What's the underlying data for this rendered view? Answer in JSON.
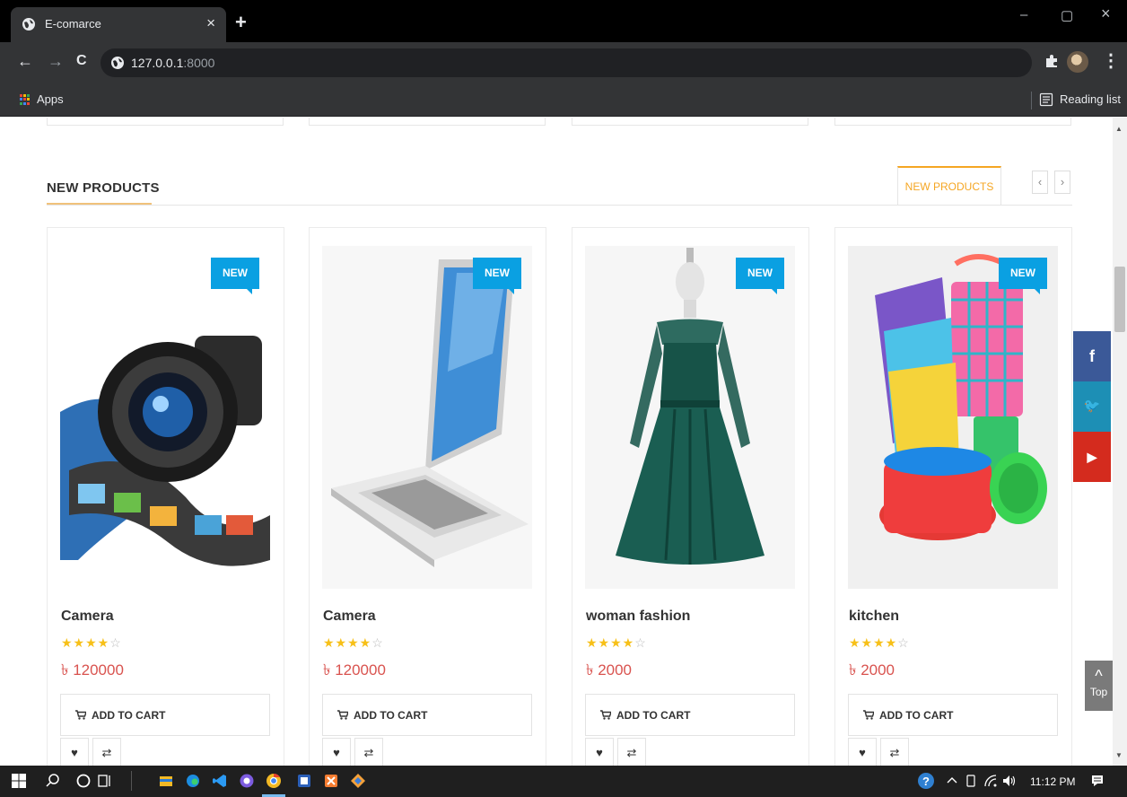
{
  "browser": {
    "tab_title": "E-comarce",
    "tab_close": "×",
    "new_tab": "+",
    "window": {
      "minimize": "–",
      "restore": "▢",
      "close": "×"
    },
    "nav": {
      "back": "←",
      "forward": "→",
      "reload": "C"
    },
    "url_host": "127.0.0.1",
    "url_port": ":8000",
    "menu": "⋮",
    "bookmarks": {
      "apps_label": "Apps",
      "reading_list_label": "Reading list"
    }
  },
  "section": {
    "title": "NEW PRODUCTS",
    "tab_label": "NEW PRODUCTS",
    "prev": "‹",
    "next": "›"
  },
  "products": [
    {
      "name": "Camera",
      "price": "৳ 120000",
      "badge": "NEW",
      "rating": 4,
      "stars_full": "★★★★",
      "stars_empty": "☆",
      "cart_label": "ADD TO CART",
      "wishlist": "♥",
      "compare": "⇄"
    },
    {
      "name": "Camera",
      "price": "৳ 120000",
      "badge": "NEW",
      "rating": 4,
      "stars_full": "★★★★",
      "stars_empty": "☆",
      "cart_label": "ADD TO CART",
      "wishlist": "♥",
      "compare": "⇄"
    },
    {
      "name": "woman fashion",
      "price": "৳ 2000",
      "badge": "NEW",
      "rating": 4,
      "stars_full": "★★★★",
      "stars_empty": "☆",
      "cart_label": "ADD TO CART",
      "wishlist": "♥",
      "compare": "⇄"
    },
    {
      "name": "kitchen",
      "price": "৳ 2000",
      "badge": "NEW",
      "rating": 4,
      "stars_full": "★★★★",
      "stars_empty": "☆",
      "cart_label": "ADD TO CART",
      "wishlist": "♥",
      "compare": "⇄"
    }
  ],
  "social": {
    "facebook": "f",
    "twitter": "🐦",
    "youtube": "▶",
    "colors": {
      "facebook": "#3b5998",
      "twitter": "#1d8fb5",
      "youtube": "#d42b1e"
    }
  },
  "scroll_top": {
    "chevron": "^",
    "label": "Top"
  },
  "taskbar": {
    "time": "11:12 PM"
  },
  "colors": {
    "accent": "#f5a623",
    "badge": "#0aa0e2",
    "price": "#d9534f",
    "star": "#f7c018"
  }
}
